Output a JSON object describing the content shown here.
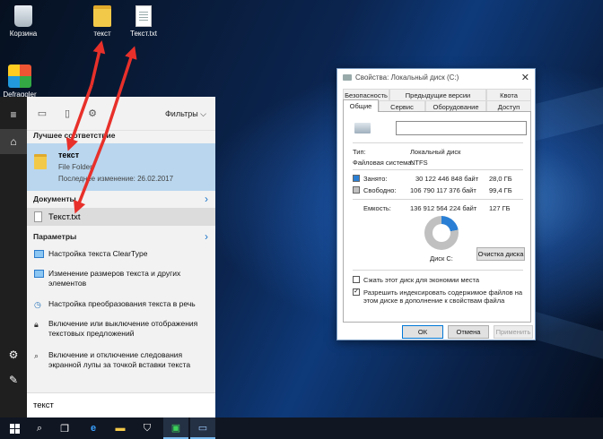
{
  "desktop": {
    "icons": [
      {
        "label": "Корзина",
        "icon": "recycle-bin-icon"
      },
      {
        "label": "текст",
        "icon": "folder-icon"
      },
      {
        "label": "Текст.txt",
        "icon": "text-file-icon"
      },
      {
        "label": "Defraggler",
        "icon": "defraggler-icon"
      }
    ]
  },
  "start_menu": {
    "filters_label": "Фильтры",
    "best_match": {
      "header": "Лучшее соответствие",
      "name": "текст",
      "type": "File Folder",
      "modified": "Последнее изменение: 26.02.2017"
    },
    "documents": {
      "header": "Документы",
      "item": "Текст.txt"
    },
    "settings": {
      "header": "Параметры",
      "items": [
        "Настройка текста ClearType",
        "Изменение размеров текста и других элементов",
        "Настройка преобразования текста в речь",
        "Включение или выключение отображения текстовых предложений",
        "Включение и отключение следования экранной лупы за точкой вставки текста"
      ]
    },
    "search_query": "текст"
  },
  "dialog": {
    "title": "Свойства: Локальный диск (C:)",
    "tabs_row1": [
      "Безопасность",
      "Предыдущие версии",
      "Квота"
    ],
    "tabs_row2": [
      "Общие",
      "Сервис",
      "Оборудование",
      "Доступ"
    ],
    "name_value": "",
    "type_label": "Тип:",
    "type_value": "Локальный диск",
    "fs_label": "Файловая система:",
    "fs_value": "NTFS",
    "used_label": "Занято:",
    "used_bytes": "30 122 446 848 байт",
    "used_gb": "28,0 ГБ",
    "free_label": "Свободно:",
    "free_bytes": "106 790 117 376 байт",
    "free_gb": "99,4 ГБ",
    "capacity_label": "Емкость:",
    "capacity_bytes": "136 912 564 224 байт",
    "capacity_gb": "127 ГБ",
    "disk_label": "Диск C:",
    "cleanup_button": "Очистка диска",
    "compress_label": "Сжать этот диск для экономии места",
    "compress_checked": false,
    "index_label": "Разрешить индексировать содержимое файлов на этом диске в дополнение к свойствам файла",
    "index_checked": true,
    "used_fraction": 0.22,
    "colors": {
      "used": "#2a7fd4",
      "free": "#c0c0c0"
    },
    "ok_button": "ОК",
    "cancel_button": "Отмена",
    "apply_button": "Применить"
  },
  "annotation_color": "#e8302a"
}
